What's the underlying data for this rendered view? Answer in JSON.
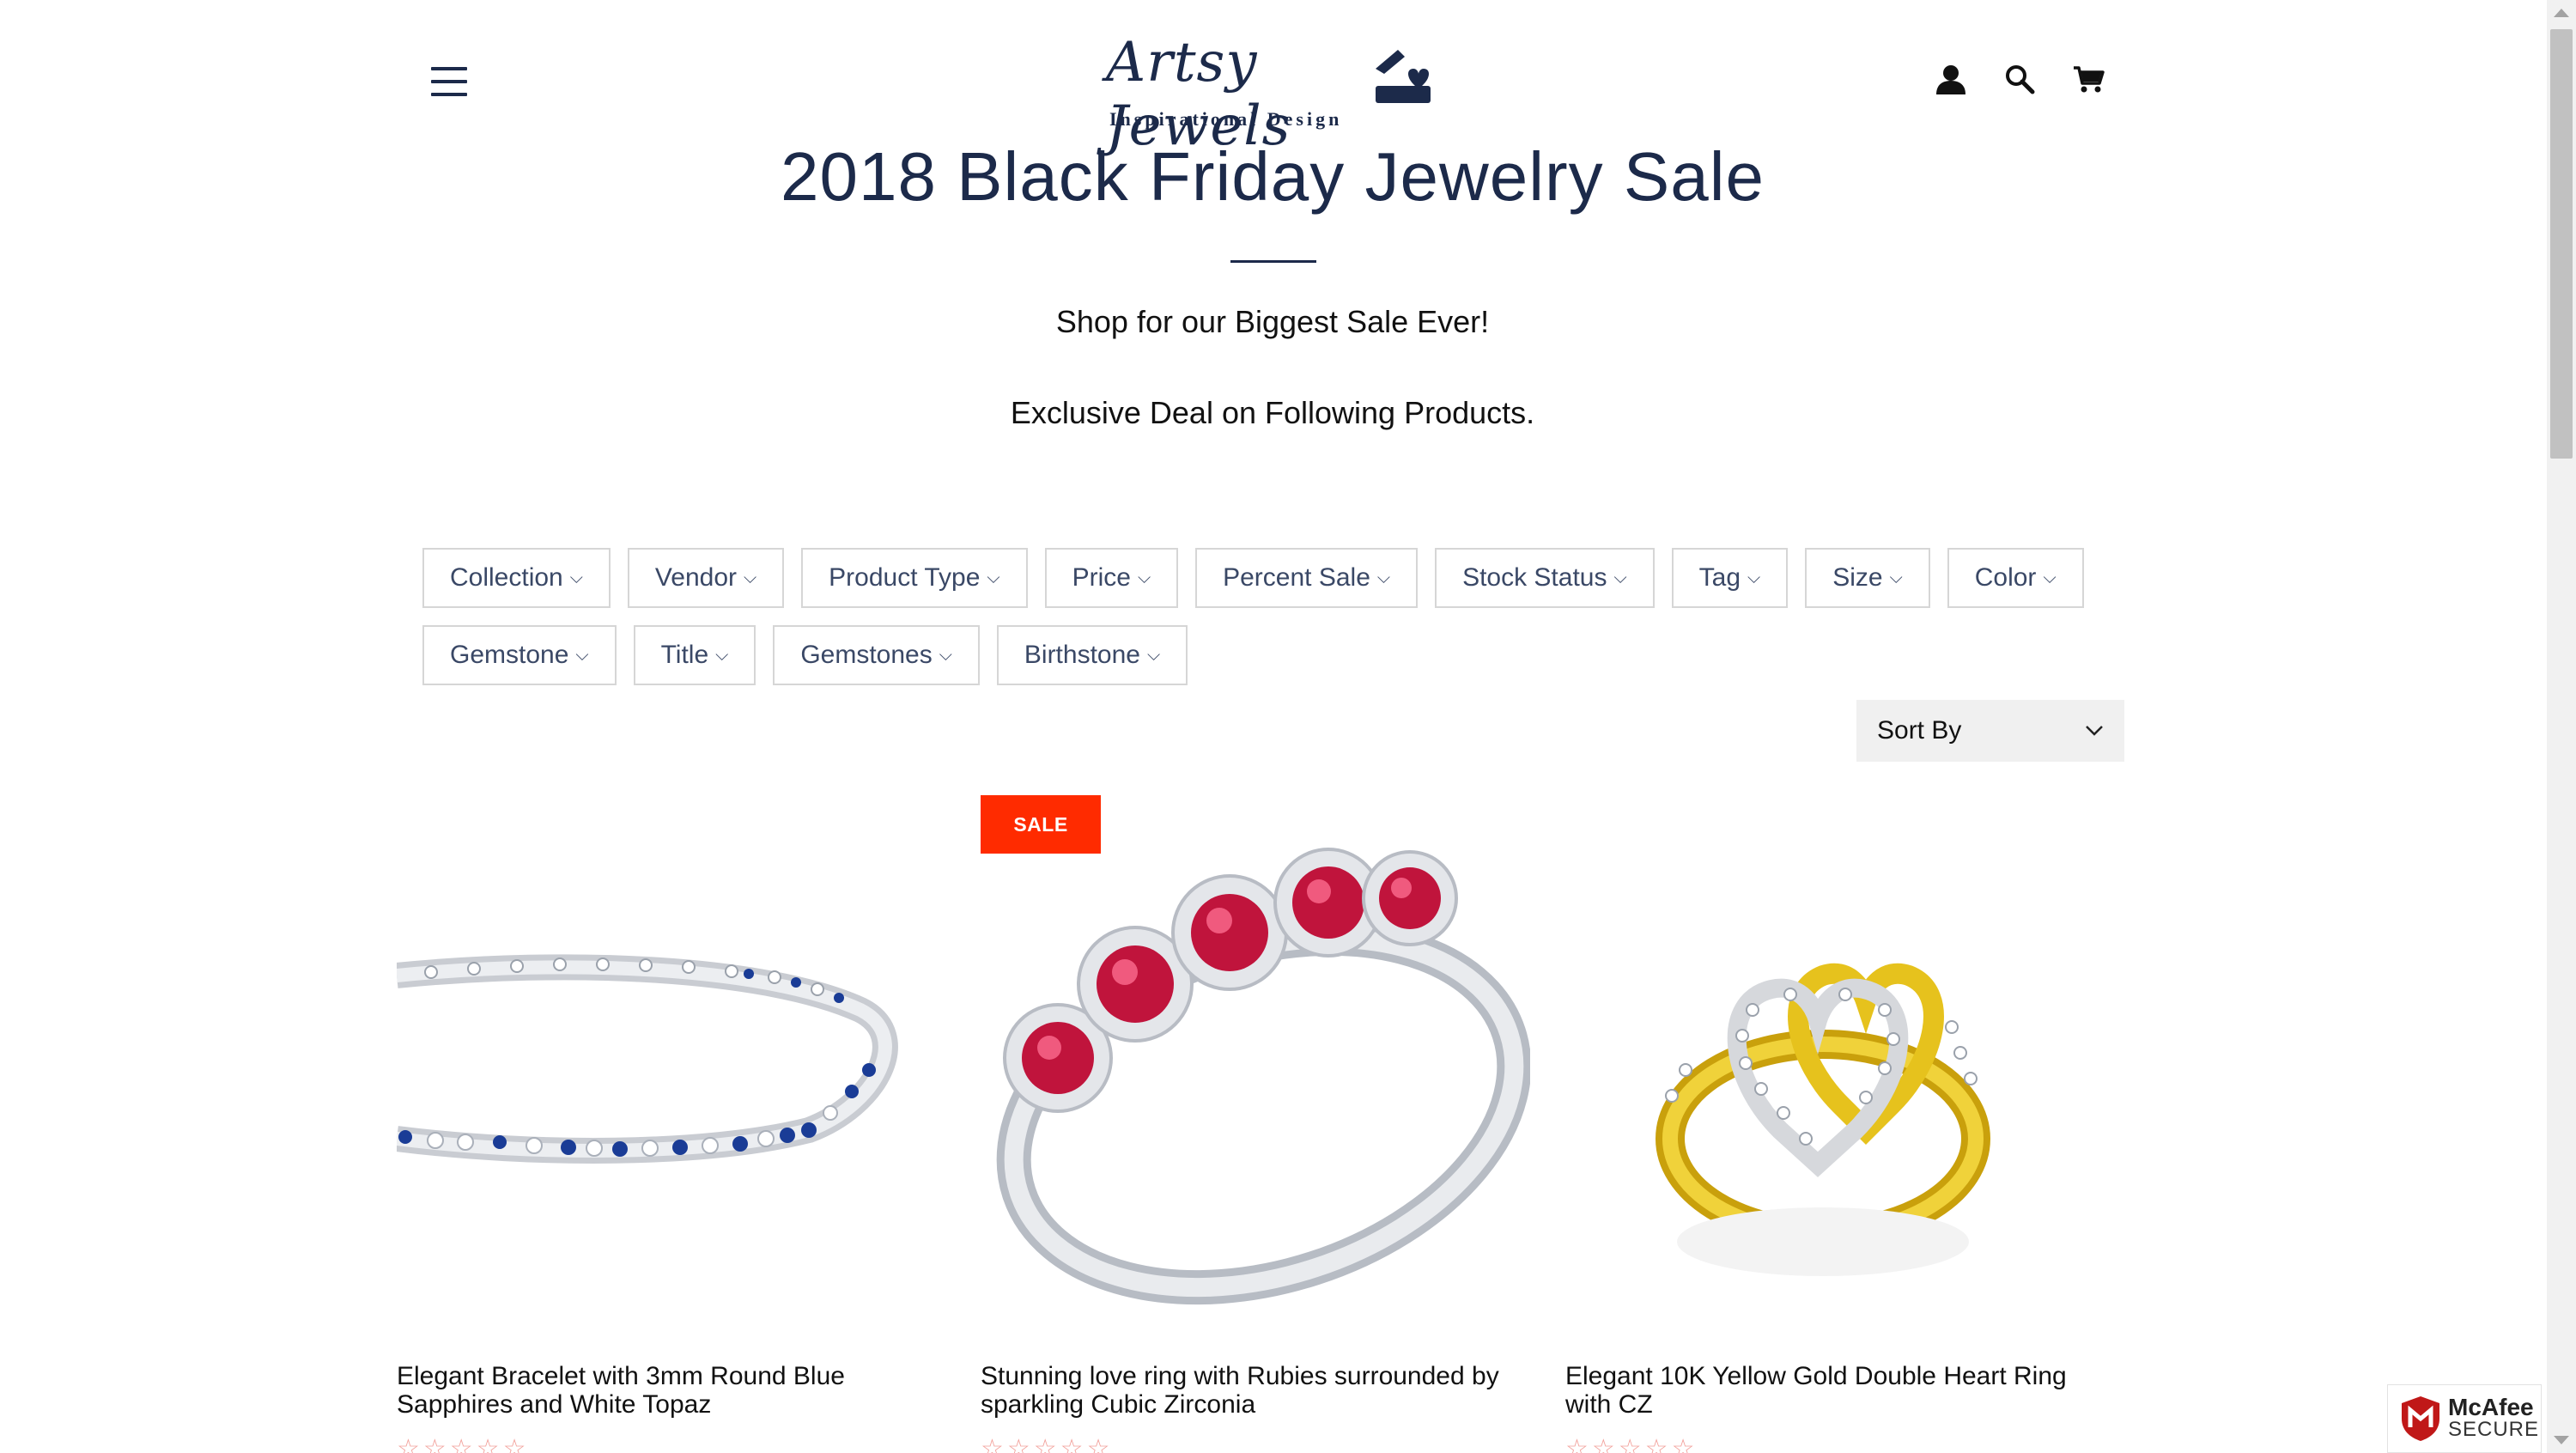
{
  "header": {
    "logo_script": "Artsy Jewels",
    "logo_tagline": "Inspirational Design",
    "icons": [
      "menu-icon",
      "account-icon",
      "search-icon",
      "cart-icon"
    ]
  },
  "page": {
    "title": "2018 Black Friday Jewelry Sale",
    "subtitle_1": "Shop for our Biggest Sale Ever!",
    "subtitle_2": "Exclusive Deal on Following Products."
  },
  "filters": [
    "Collection",
    "Vendor",
    "Product Type",
    "Price",
    "Percent Sale",
    "Stock Status",
    "Tag",
    "Size",
    "Color",
    "Gemstone",
    "Title",
    "Gemstones",
    "Birthstone"
  ],
  "sort": {
    "label": "Sort By"
  },
  "products": [
    {
      "title": "Elegant Bracelet with 3mm Round Blue Sapphires and White Topaz",
      "badge": "",
      "stars": "☆☆☆☆☆"
    },
    {
      "title": "Stunning love ring with Rubies surrounded by sparkling Cubic Zirconia",
      "badge": "SALE",
      "stars": "☆☆☆☆☆"
    },
    {
      "title": "Elegant 10K Yellow Gold Double Heart Ring with CZ",
      "badge": "",
      "stars": "☆☆☆☆☆"
    }
  ],
  "trust_badge": {
    "brand": "McAfee",
    "label": "SECURE"
  },
  "colors": {
    "primary": "#1c2a4a",
    "sale": "#ff2b00",
    "stars": "#f2a09a"
  }
}
